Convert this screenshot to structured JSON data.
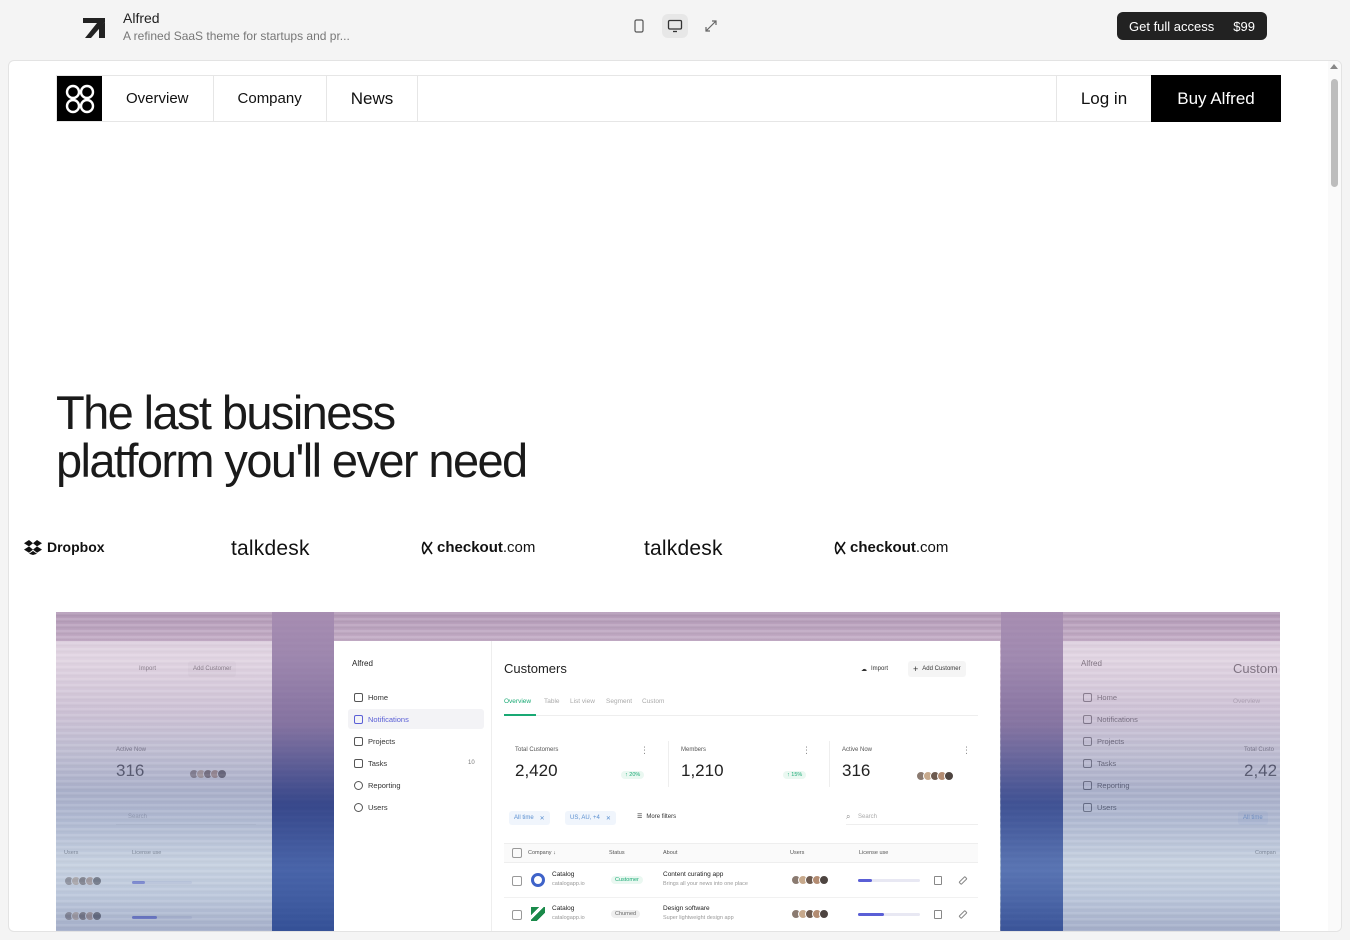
{
  "topbar": {
    "title": "Alfred",
    "subtitle": "A refined SaaS theme for startups and pr...",
    "devices": [
      "mobile-icon",
      "desktop-icon",
      "expand-icon"
    ],
    "cta_label": "Get full access",
    "cta_price": "$99"
  },
  "nav": {
    "items": [
      "Overview",
      "Company",
      "News"
    ],
    "login": "Log in",
    "buy": "Buy Alfred"
  },
  "hero": {
    "line1": "The last business",
    "line2": "platform you'll ever need"
  },
  "logos": {
    "dropbox": "Dropbox",
    "talkdesk": "talkdesk",
    "checkout_bold": "checkout",
    "checkout_tld": ".com"
  },
  "dashboard": {
    "brand": "Alfred",
    "sidebar": [
      {
        "label": "Home"
      },
      {
        "label": "Notifications",
        "active": true
      },
      {
        "label": "Projects"
      },
      {
        "label": "Tasks",
        "count": "10"
      },
      {
        "label": "Reporting"
      },
      {
        "label": "Users"
      }
    ],
    "title": "Customers",
    "import_label": "Import",
    "add_label": "Add Customer",
    "tabs": [
      "Overview",
      "Table",
      "List view",
      "Segment",
      "Custom"
    ],
    "stats": [
      {
        "label": "Total Customers",
        "value": "2,420",
        "change": "20%"
      },
      {
        "label": "Members",
        "value": "1,210",
        "change": "15%"
      },
      {
        "label": "Active Now",
        "value": "316"
      }
    ],
    "chips": [
      "All time",
      "US, AU, +4"
    ],
    "more_filters": "More filters",
    "search_placeholder": "Search",
    "columns": [
      "Company",
      "Status",
      "About",
      "Users",
      "License use"
    ],
    "rows": [
      {
        "company": "Catalog",
        "url": "catalogapp.io",
        "status": "Customer",
        "about": "Content curating app",
        "about_sub": "Brings all your news into one place",
        "license": 0.22
      },
      {
        "company": "Catalog",
        "url": "catalogapp.io",
        "status": "Churned",
        "about": "Design software",
        "about_sub": "Super lightweight design app",
        "license": 0.42
      }
    ],
    "ghost_left": {
      "import_label": "Import",
      "add_label": "Add Customer",
      "stat_label": "Active Now",
      "stat_value": "316",
      "search_placeholder": "Search",
      "col_users": "Users",
      "col_license": "License use"
    },
    "ghost_right": {
      "brand": "Alfred",
      "title": "Custom",
      "stat_label": "Total Custo",
      "stat_value": "2,42",
      "tab": "Overview",
      "chip": "All time",
      "col": "Compan"
    }
  }
}
